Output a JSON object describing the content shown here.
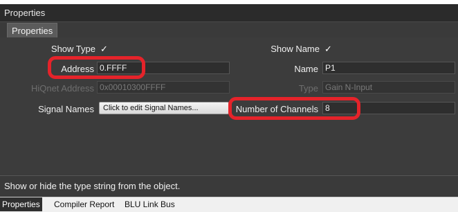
{
  "window": {
    "title": "Properties"
  },
  "tabs": {
    "active": "Properties"
  },
  "props": {
    "show_type_label": "Show Type",
    "show_type_check": "✓",
    "show_name_label": "Show Name",
    "show_name_check": "✓",
    "address_label": "Address",
    "address_value": "0.FFFF",
    "name_label": "Name",
    "name_value": "P1",
    "hiqnet_label": "HiQnet Address",
    "hiqnet_value": "0x00010300FFFF",
    "type_label": "Type",
    "type_value": "Gain N-Input",
    "signal_names_label": "Signal Names",
    "signal_names_button": "Click to edit Signal Names...",
    "channels_label": "Number of Channels",
    "channels_value": "8"
  },
  "status": {
    "text": "Show or hide the type string from the object."
  },
  "bottom_tabs": [
    "Properties",
    "Compiler Report",
    "BLU Link Bus"
  ],
  "colors": {
    "highlight": "#e5232a",
    "panel": "#3c3c3c"
  }
}
